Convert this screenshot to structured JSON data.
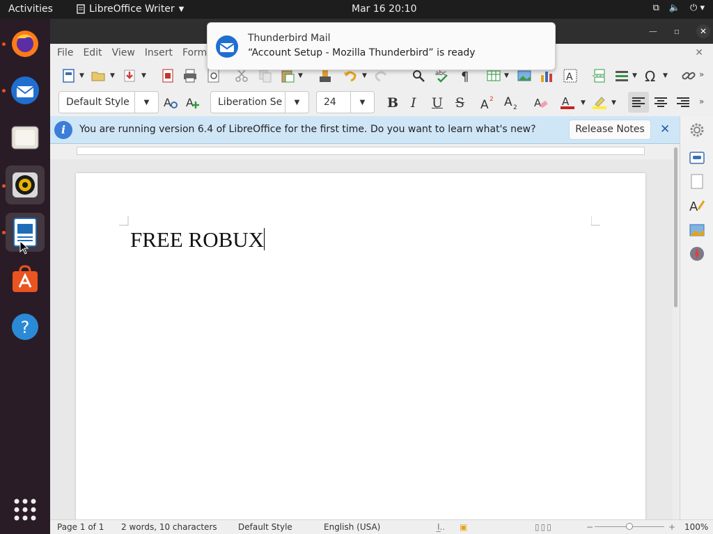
{
  "topbar": {
    "activities": "Activities",
    "app_name": "LibreOffice Writer",
    "clock": "Mar 16  20:10"
  },
  "notification": {
    "title": "Thunderbird Mail",
    "body": "“Account Setup - Mozilla Thunderbird” is ready"
  },
  "menubar": {
    "items": [
      "File",
      "Edit",
      "View",
      "Insert",
      "Form"
    ]
  },
  "formatting": {
    "paragraph_style": "Default Style",
    "font_name": "Liberation Se",
    "font_size": "24"
  },
  "infobar": {
    "message": "You are running version 6.4 of LibreOffice for the first time. Do you want to learn what's new?",
    "button": "Release Notes"
  },
  "document": {
    "text": "FREE ROBUX"
  },
  "statusbar": {
    "page": "Page 1 of 1",
    "counts": "2 words, 10 characters",
    "style": "Default Style",
    "language": "English (USA)",
    "zoom": "100%"
  },
  "colors": {
    "accent": "#e95420",
    "infobar_bg": "#cfe6f7"
  }
}
